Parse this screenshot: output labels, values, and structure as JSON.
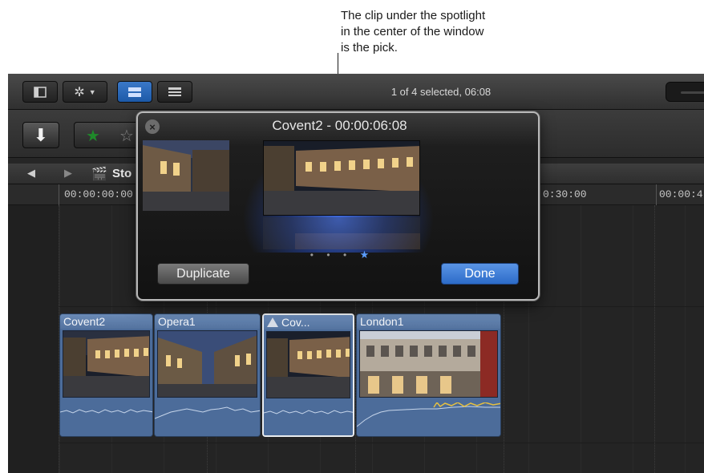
{
  "callout": {
    "lines": [
      "The clip under the spotlight",
      "in the center of the window",
      "is the pick."
    ]
  },
  "toolbar": {
    "status": "1 of 4 selected, 06:08",
    "icons": [
      "sidebar-toggle-icon",
      "gear-icon",
      "filmstrip-view-icon",
      "list-view-icon"
    ]
  },
  "toolbar2": {
    "import_icon": "down-arrow-icon",
    "rating_icons": [
      "favorite-star-icon",
      "unrate-star-icon"
    ]
  },
  "navbar": {
    "project_name": "Sto"
  },
  "ruler": {
    "timecodes": [
      "00:00:00:00",
      "0:30:00",
      "00:00:4"
    ]
  },
  "popover": {
    "title": "Covent2 - 00:00:06:08",
    "duplicate_label": "Duplicate",
    "done_label": "Done",
    "page_dots": [
      "•",
      "•",
      "•",
      "★"
    ]
  },
  "clips": [
    {
      "name": "Covent2"
    },
    {
      "name": "Opera1"
    },
    {
      "name": "Cov..."
    },
    {
      "name": "London1"
    }
  ],
  "colors": {
    "accent_blue": "#2c6bc8",
    "clip_blue": "#4c6c9a",
    "spotlight": "#4678ff"
  }
}
